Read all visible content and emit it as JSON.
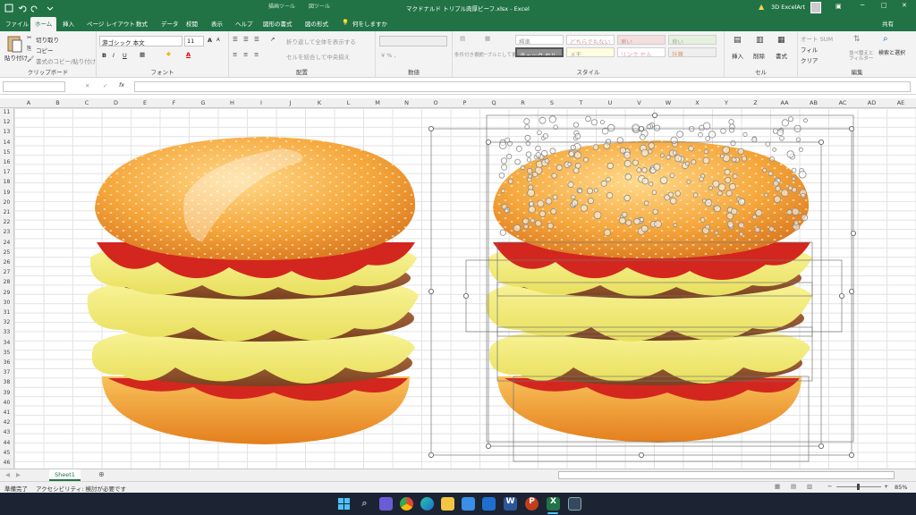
{
  "title_bar": {
    "ctx_drawing": "描画ツール",
    "ctx_picture": "図ツール",
    "filename": "マクドナルド トリプル肉厚ビーフ.xlsx - Excel",
    "user": "3D ExcelArt",
    "undo_icon": "undo-icon",
    "redo_icon": "redo-icon"
  },
  "ribbon_tabs": [
    "ファイル",
    "ホーム",
    "挿入",
    "ページ レイアウト",
    "数式",
    "データ",
    "校閲",
    "表示",
    "ヘルプ",
    "図形の書式",
    "図の形式"
  ],
  "active_tab": "ホーム",
  "tell_me": "何をしますか",
  "share": "共有",
  "clipboard": {
    "paste": "貼り付け",
    "cut": "切り取り",
    "copy": "コピー",
    "painter": "書式のコピー/貼り付け",
    "label": "クリップボード"
  },
  "font": {
    "name": "游ゴシック 本文",
    "size": "11",
    "label": "フォント",
    "bold": "B",
    "italic": "I",
    "underline": "U",
    "grow": "A",
    "shrink": "A"
  },
  "alignment": {
    "wrap": "折り返して全体を表示する",
    "merge": "セルを結合して中央揃え",
    "label": "配置"
  },
  "number": {
    "format": "",
    "label": "数値"
  },
  "styles": {
    "conditional": "条件付き書式",
    "table": "テーブルとして書式設定",
    "cells": [
      "標準",
      "どちらでもない",
      "悪い",
      "良い",
      "チェック セル",
      "メモ",
      "リンク セル",
      "計算"
    ],
    "label": "スタイル"
  },
  "cells_group": {
    "insert": "挿入",
    "delete": "削除",
    "format": "書式",
    "label": "セル"
  },
  "editing": {
    "autosum": "オート SUM",
    "fill": "フィル",
    "clear": "クリア",
    "sort": "並べ替えとフィルター",
    "find": "検索と選択",
    "label": "編集"
  },
  "formula_bar": {
    "name_box": "",
    "fx": "fx",
    "formula": ""
  },
  "columns": [
    "A",
    "B",
    "C",
    "D",
    "E",
    "F",
    "G",
    "H",
    "I",
    "J",
    "K",
    "L",
    "M",
    "N",
    "O",
    "P",
    "Q",
    "R",
    "S",
    "T",
    "U",
    "V",
    "W",
    "X",
    "Y",
    "Z",
    "AA",
    "AB",
    "AC",
    "AD",
    "AE"
  ],
  "rows": [
    "11",
    "12",
    "13",
    "14",
    "15",
    "16",
    "17",
    "18",
    "19",
    "20",
    "21",
    "22",
    "23",
    "24",
    "25",
    "26",
    "27",
    "28",
    "29",
    "30",
    "31",
    "32",
    "33",
    "34",
    "35",
    "36",
    "37",
    "38",
    "39",
    "40",
    "41",
    "42",
    "43",
    "44",
    "45",
    "46"
  ],
  "sheet_tab": "Sheet1",
  "status": {
    "ready": "準備完了",
    "accessibility": "アクセシビリティ: 検討が必要です",
    "zoom": "85%"
  },
  "taskbar_icons": [
    "windows-start-icon",
    "search-icon",
    "chat-icon",
    "chrome-icon",
    "edge-icon",
    "file-explorer-icon",
    "store-icon",
    "mail-icon",
    "word-icon",
    "powerpoint-icon",
    "excel-icon",
    "app-icon"
  ],
  "colors": {
    "excel_green": "#217346",
    "bun": "#f2a33a",
    "cheese": "#f0ea7a",
    "patty": "#9a5a32",
    "ketchup": "#d3261e",
    "selection": "#888888"
  }
}
